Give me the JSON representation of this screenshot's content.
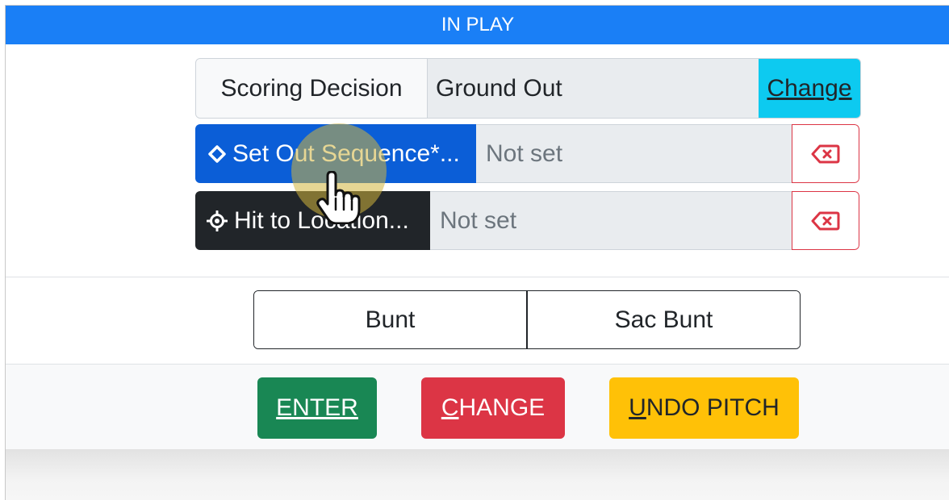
{
  "header": {
    "title": "IN PLAY"
  },
  "scoring": {
    "label": "Scoring Decision",
    "value": "Ground Out",
    "change_label": "Change"
  },
  "out_sequence": {
    "button_label": "Set Out Sequence*...",
    "value": "Not set",
    "icon": "diamond-icon",
    "clear_icon": "backspace-x-icon"
  },
  "hit_location": {
    "button_label": "Hit to Location...",
    "value": "Not set",
    "icon": "crosshair-icon",
    "clear_icon": "backspace-x-icon"
  },
  "bunt_options": [
    {
      "label": "Bunt"
    },
    {
      "label": "Sac Bunt"
    }
  ],
  "footer": {
    "enter_label": "ENTER",
    "change_label": "CHANGE",
    "undo_label": "UNDO PITCH"
  },
  "colors": {
    "header": "#1a7ff6",
    "info": "#0dcaf0",
    "primary": "#0b5ed7",
    "dark": "#212529",
    "danger": "#dc3545",
    "success": "#198754",
    "warning": "#ffc107"
  }
}
